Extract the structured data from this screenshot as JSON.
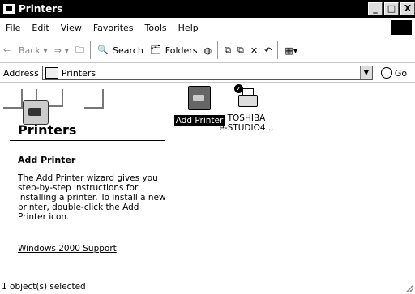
{
  "window": {
    "title": "Printers",
    "controls": [
      "_",
      "□",
      "X"
    ]
  },
  "menu": [
    "File",
    "Edit",
    "View",
    "Favorites",
    "Tools",
    "Help"
  ],
  "toolbar": {
    "back": "Back",
    "search": "Search",
    "folders": "Folders"
  },
  "address": {
    "label": "Address",
    "value": "Printers",
    "go": "Go"
  },
  "left_pane": {
    "title": "Printers",
    "section_title": "Add Printer",
    "description": "The Add Printer wizard gives you step-by-step instructions for installing a printer. To install a new printer, double-click the Add Printer icon.",
    "support_link": "Windows 2000 Support"
  },
  "items": [
    {
      "label": "Add Printer",
      "selected": true
    },
    {
      "label_line1": "TOSHIBA",
      "label_line2": "e-STUDIO4...",
      "selected": false
    }
  ],
  "status": {
    "text": "1 object(s) selected"
  }
}
